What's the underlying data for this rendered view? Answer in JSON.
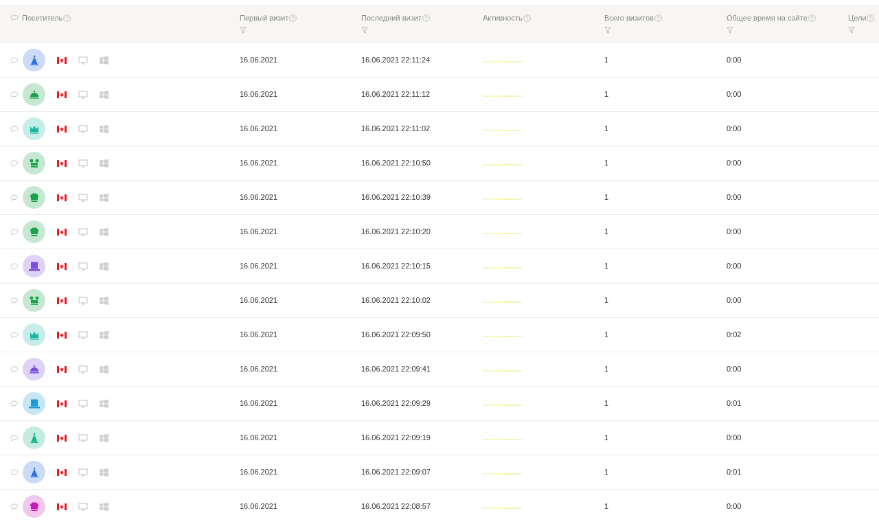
{
  "columns": [
    {
      "label": "Посетитель",
      "filter": false
    },
    {
      "label": "Первый визит",
      "filter": true
    },
    {
      "label": "Последний визит",
      "filter": true
    },
    {
      "label": "Активность",
      "filter": false
    },
    {
      "label": "Всего визитов",
      "filter": true
    },
    {
      "label": "Общее время на сайте",
      "filter": true
    },
    {
      "label": "Цели",
      "filter": true
    }
  ],
  "rows": [
    {
      "avatar": {
        "kind": "cone",
        "color": "#2f6fe0"
      },
      "first_visit": "16.06.2021",
      "last_visit": "16.06.2021 22:11:24",
      "visits": "1",
      "time": "0:00"
    },
    {
      "avatar": {
        "kind": "dome",
        "color": "#1aa34a"
      },
      "first_visit": "16.06.2021",
      "last_visit": "16.06.2021 22:11:12",
      "visits": "1",
      "time": "0:00"
    },
    {
      "avatar": {
        "kind": "crown",
        "color": "#19b5a5"
      },
      "first_visit": "16.06.2021",
      "last_visit": "16.06.2021 22:11:02",
      "visits": "1",
      "time": "0:00"
    },
    {
      "avatar": {
        "kind": "mouse",
        "color": "#1aa34a"
      },
      "first_visit": "16.06.2021",
      "last_visit": "16.06.2021 22:10:50",
      "visits": "1",
      "time": "0:00"
    },
    {
      "avatar": {
        "kind": "chef",
        "color": "#1aa34a"
      },
      "first_visit": "16.06.2021",
      "last_visit": "16.06.2021 22:10:39",
      "visits": "1",
      "time": "0:00"
    },
    {
      "avatar": {
        "kind": "chef",
        "color": "#1aa34a"
      },
      "first_visit": "16.06.2021",
      "last_visit": "16.06.2021 22:10:20",
      "visits": "1",
      "time": "0:00"
    },
    {
      "avatar": {
        "kind": "hat",
        "color": "#7a4de0"
      },
      "first_visit": "16.06.2021",
      "last_visit": "16.06.2021 22:10:15",
      "visits": "1",
      "time": "0:00"
    },
    {
      "avatar": {
        "kind": "mouse",
        "color": "#1aa34a"
      },
      "first_visit": "16.06.2021",
      "last_visit": "16.06.2021 22:10:02",
      "visits": "1",
      "time": "0:00"
    },
    {
      "avatar": {
        "kind": "crown",
        "color": "#19b5a5"
      },
      "first_visit": "16.06.2021",
      "last_visit": "16.06.2021 22:09:50",
      "visits": "1",
      "time": "0:02"
    },
    {
      "avatar": {
        "kind": "dome",
        "color": "#7a4de0"
      },
      "first_visit": "16.06.2021",
      "last_visit": "16.06.2021 22:09:41",
      "visits": "1",
      "time": "0:00"
    },
    {
      "avatar": {
        "kind": "hat",
        "color": "#1c9ad6"
      },
      "first_visit": "16.06.2021",
      "last_visit": "16.06.2021 22:09:29",
      "visits": "1",
      "time": "0:01"
    },
    {
      "avatar": {
        "kind": "cone",
        "color": "#19b38c"
      },
      "first_visit": "16.06.2021",
      "last_visit": "16.06.2021 22:09:19",
      "visits": "1",
      "time": "0:00"
    },
    {
      "avatar": {
        "kind": "cone",
        "color": "#2f6fe0"
      },
      "first_visit": "16.06.2021",
      "last_visit": "16.06.2021 22:09:07",
      "visits": "1",
      "time": "0:01"
    },
    {
      "avatar": {
        "kind": "chef",
        "color": "#c81fb8"
      },
      "first_visit": "16.06.2021",
      "last_visit": "16.06.2021 22:08:57",
      "visits": "1",
      "time": "0:00"
    }
  ]
}
